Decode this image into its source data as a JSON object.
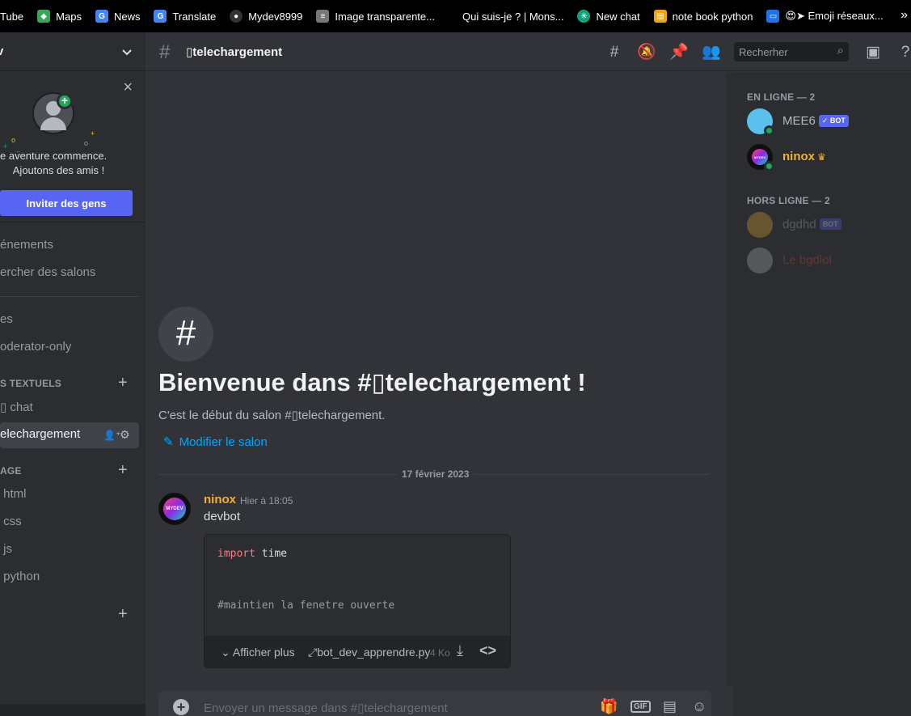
{
  "bookmarks": [
    {
      "label": "Tube",
      "icon": "youtube-icon",
      "color": "#ff0000"
    },
    {
      "label": "Maps",
      "icon": "maps-icon",
      "color": "#34a853"
    },
    {
      "label": "News",
      "icon": "news-icon",
      "color": "#4285f4"
    },
    {
      "label": "Translate",
      "icon": "translate-icon",
      "color": "#4285f4"
    },
    {
      "label": "Mydev8999",
      "icon": "github-icon",
      "color": "#333333"
    },
    {
      "label": "Image transparente...",
      "icon": "layers-icon",
      "color": "#777777"
    },
    {
      "label": "Qui suis-je ? | Mons...",
      "icon": "blank-icon",
      "color": "#000000"
    },
    {
      "label": "New chat",
      "icon": "openai-icon",
      "color": "#10a37f"
    },
    {
      "label": "note book python",
      "icon": "notebook-icon",
      "color": "#f0a30a"
    },
    {
      "label": "😍➤ Emoji réseaux...",
      "icon": "emoji-icon",
      "color": "#1a73e8"
    }
  ],
  "bookmarks_more": "»",
  "server": {
    "name": "v"
  },
  "invite": {
    "line1": "ne aventure commence.",
    "line2": "Ajoutons des amis !",
    "button": "Inviter des gens",
    "close": "×"
  },
  "nav": {
    "events": "énements",
    "browse": "ercher des salons",
    "rules": "es",
    "moderator": "oderator-only"
  },
  "categories": {
    "text": "S TEXTUELS",
    "lang": "AGE"
  },
  "channels": {
    "chat": "chat",
    "active": "elechargement",
    "html": "html",
    "css": "css",
    "js": "js",
    "python": "python"
  },
  "topbar": {
    "channel": "▯telechargement",
    "search_placeholder": "Recherher"
  },
  "welcome": {
    "title": "Bienvenue dans #▯telechargement !",
    "subtitle": "C'est le début du salon #▯telechargement.",
    "edit": "Modifier le salon"
  },
  "date_divider": "17 février 2023",
  "message": {
    "author": "ninox",
    "time": "Hier à 18:05",
    "text": "devbot",
    "avatar_text": "MYDEV",
    "code": {
      "line1_kw": "import",
      "line1_rest": " time",
      "line2": "#maintien la fenetre ouverte"
    },
    "attachment": {
      "expand": "Afficher plus",
      "filename": "bot_dev_apprendre.py",
      "size": "4 Ko"
    }
  },
  "composer": {
    "placeholder": "Envoyer un message dans #▯telechargement",
    "gif": "GIF"
  },
  "members": {
    "online_header": "EN LIGNE — 2",
    "offline_header": "HORS LIGNE — 2",
    "online": [
      {
        "name": "MEE6",
        "bot": "✓ BOT",
        "color": "#b5bac1"
      },
      {
        "name": "ninox",
        "color": "#f0b232"
      }
    ],
    "offline": [
      {
        "name": "dgdhd",
        "bot": "BOT",
        "color": "#b5bac1"
      },
      {
        "name": "Le bgdlol",
        "color": "#e74c3c"
      }
    ],
    "avatar_text": "MYDEV"
  }
}
